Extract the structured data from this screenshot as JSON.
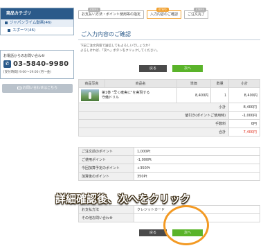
{
  "sidebar": {
    "category_title": "商品カテゴリ",
    "categories": [
      "ジャパンライム動画(46)",
      "スポーツ(46)"
    ],
    "contact_heading": "お電話からのお問い合わせ",
    "phone": "03-5840-9980",
    "hours": "[受付時間] 9:00〜19:00 (月〜金)",
    "mail_button": "お問い合わせはこちら"
  },
  "steps": [
    {
      "no": "STEP1",
      "label": "お支払い方法・ポイント使用等の指定"
    },
    {
      "no": "STEP2",
      "label": "入力内容のご確認"
    },
    {
      "no": "STEP3",
      "label": "ご注文完了"
    }
  ],
  "page_title": "ご入力内容のご確認",
  "intro": [
    "下記ご注文内容で送信してもよろしいでしょうか?",
    "よろしければ、「次へ」ボタンをクリックしてください。"
  ],
  "buttons": {
    "back": "戻る",
    "next": "次へ"
  },
  "products": {
    "headers": [
      "商品写真",
      "商品名",
      "単価",
      "数量",
      "小計"
    ],
    "rows": [
      {
        "name": "第1巻 \"早く確実に\"を実現する守備ドリル",
        "price": "8,400円",
        "qty": "1",
        "subtotal": "8,400円"
      }
    ],
    "summary": [
      {
        "label": "小計",
        "value": "8,400円",
        "highlight": false
      },
      {
        "label": "値引き(ポイントご使用時)",
        "value": "-1,000円",
        "highlight": false
      },
      {
        "label": "手数料",
        "value": "0円",
        "highlight": false
      },
      {
        "label": "合計",
        "value": "7,400円",
        "highlight": true
      }
    ]
  },
  "points": [
    {
      "label": "ご注文前のポイント",
      "value": "1,000Pt"
    },
    {
      "label": "ご使用ポイント",
      "value": "-1,000Pt"
    },
    {
      "label": "今回加算予定のポイント",
      "value": "+350Pt"
    },
    {
      "label": "加算後のポイント",
      "value": "350Pt"
    }
  ],
  "payment": [
    {
      "label": "お支払方法",
      "value": "クレジットカード"
    },
    {
      "label": "その他お問い合わせ",
      "value": ""
    }
  ],
  "overlay_caption": "詳細確認後、次へをクリック",
  "colors": {
    "accent": "#2a5a8a",
    "next_button": "#5ab32a",
    "step_active": "#f0a030",
    "total": "#e0301e",
    "highlight_circle": "#f39a24"
  }
}
